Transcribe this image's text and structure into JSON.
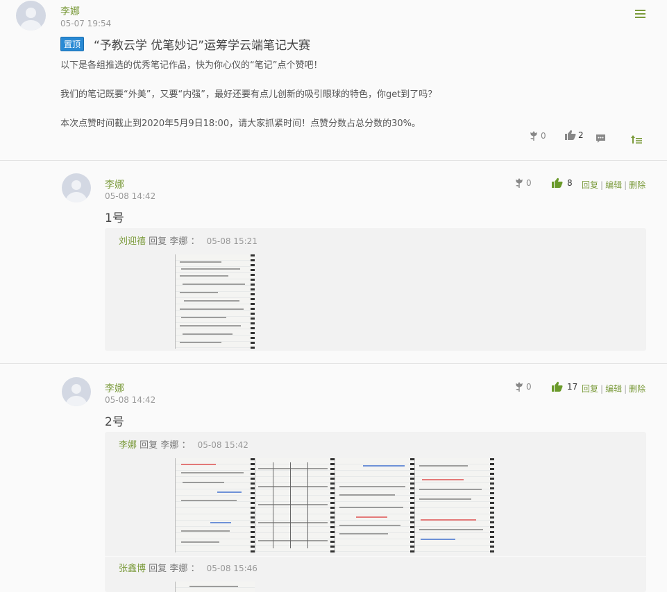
{
  "post": {
    "author": "李娜",
    "time": "05-07 19:54",
    "pin_badge": "置顶",
    "title": "“予教云学 优笔妙记”运筹学云端笔记大赛",
    "paragraphs": [
      "以下是各组推选的优秀笔记作品，快为你心仪的“笔记”点个赞吧！",
      "我们的笔记既要“外美”，又要“内强”，最好还要有点儿创新的吸引眼球的特色，你get到了吗？",
      "本次点赞时间截止到2020年5月9日18:00，请大家抓紧时间！点赞分数占总分数的30%。"
    ],
    "flower_count": "0",
    "like_count": "2"
  },
  "comments": [
    {
      "author": "李娜",
      "time": "05-08 14:42",
      "floor": "1号",
      "flower_count": "0",
      "like_count": "8",
      "actions": {
        "reply": "回复",
        "edit": "编辑",
        "delete": "删除"
      },
      "reply": {
        "author": "刘迎禧",
        "verb": "回复",
        "target": "李娜",
        "colon": "：",
        "time": "05-08 15:21"
      }
    },
    {
      "author": "李娜",
      "time": "05-08 14:42",
      "floor": "2号",
      "flower_count": "0",
      "like_count": "17",
      "actions": {
        "reply": "回复",
        "edit": "编辑",
        "delete": "删除"
      },
      "reply": {
        "author": "李娜",
        "verb": "回复",
        "target": "李娜",
        "colon": "：",
        "time": "05-08 15:42"
      },
      "reply2": {
        "author": "张鑫博",
        "verb": "回复",
        "target": "李娜",
        "colon": "：",
        "time": "05-08 15:46"
      }
    }
  ],
  "colors": {
    "accent_green": "#7a9a3a",
    "pin_blue": "#2a8ad4",
    "like_green": "#6a9a2a"
  },
  "icons": [
    "menu-icon",
    "flower-icon",
    "thumbs-up-icon",
    "comment-icon",
    "sort-icon"
  ]
}
